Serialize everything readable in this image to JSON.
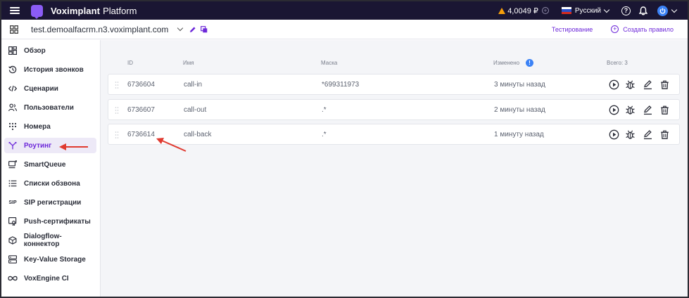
{
  "app": {
    "name": "Voximplant",
    "name_suffix": "Platform",
    "balance": "4,0049 ₽",
    "language": "Русский"
  },
  "project": {
    "name": "test.demoalfacrm.n3.voximplant.com"
  },
  "toolbar": {
    "test_label": "Тестирование",
    "add_rule_label": "Создать правило"
  },
  "sidebar": {
    "items": [
      {
        "label": "Обзор",
        "icon": "dashboard-icon"
      },
      {
        "label": "История звонков",
        "icon": "history-icon"
      },
      {
        "label": "Сценарии",
        "icon": "code-icon"
      },
      {
        "label": "Пользователи",
        "icon": "users-icon"
      },
      {
        "label": "Номера",
        "icon": "dialpad-icon"
      },
      {
        "label": "Роутинг",
        "icon": "routing-icon",
        "active": true
      },
      {
        "label": "SmartQueue",
        "icon": "queue-icon"
      },
      {
        "label": "Списки обзвона",
        "icon": "list-icon"
      },
      {
        "label": "SIP регистрации",
        "icon": "sip-icon"
      },
      {
        "label": "Push-сертификаты",
        "icon": "certificate-icon"
      },
      {
        "label": "Dialogflow-коннектор",
        "icon": "cube-icon"
      },
      {
        "label": "Key-Value Storage",
        "icon": "storage-icon"
      },
      {
        "label": "VoxEngine CI",
        "icon": "infinity-icon"
      }
    ]
  },
  "table": {
    "headers": {
      "id": "ID",
      "name": "Имя",
      "mask": "Маска",
      "modified": "Изменено",
      "total": "Всего: 3"
    },
    "rows": [
      {
        "id": "6736604",
        "name": "call-in",
        "mask": "*699311973",
        "modified": "3 минуты назад"
      },
      {
        "id": "6736607",
        "name": "call-out",
        "mask": ".*",
        "modified": "2 минуты назад"
      },
      {
        "id": "6736614",
        "name": "call-back",
        "mask": ".*",
        "modified": "1 минуту назад"
      }
    ]
  },
  "colors": {
    "topbar": "#1a1633",
    "accent": "#6d28d9",
    "annotation_arrow": "#e03a30"
  }
}
